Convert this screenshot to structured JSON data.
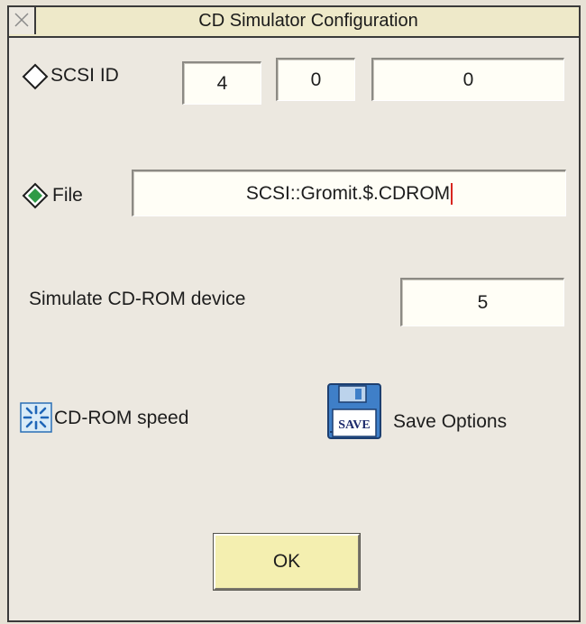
{
  "window": {
    "title": "CD Simulator Configuration"
  },
  "scsi": {
    "label": "SCSI ID",
    "selected": false,
    "fields": [
      "4",
      "0",
      "0"
    ]
  },
  "file": {
    "label": "File",
    "selected": true,
    "path": "SCSI::Gromit.$.CDROM"
  },
  "simulate": {
    "label": "Simulate CD-ROM device",
    "value": "5"
  },
  "speed": {
    "label": "CD-ROM speed"
  },
  "save": {
    "label": "Save Options",
    "icon_text": "SAVE"
  },
  "ok_button": {
    "label": "OK"
  },
  "colors": {
    "accent": "#2f9a46",
    "title_bg": "#eee9c9",
    "button_bg": "#f4efb0",
    "field_bg": "#fffef6"
  }
}
